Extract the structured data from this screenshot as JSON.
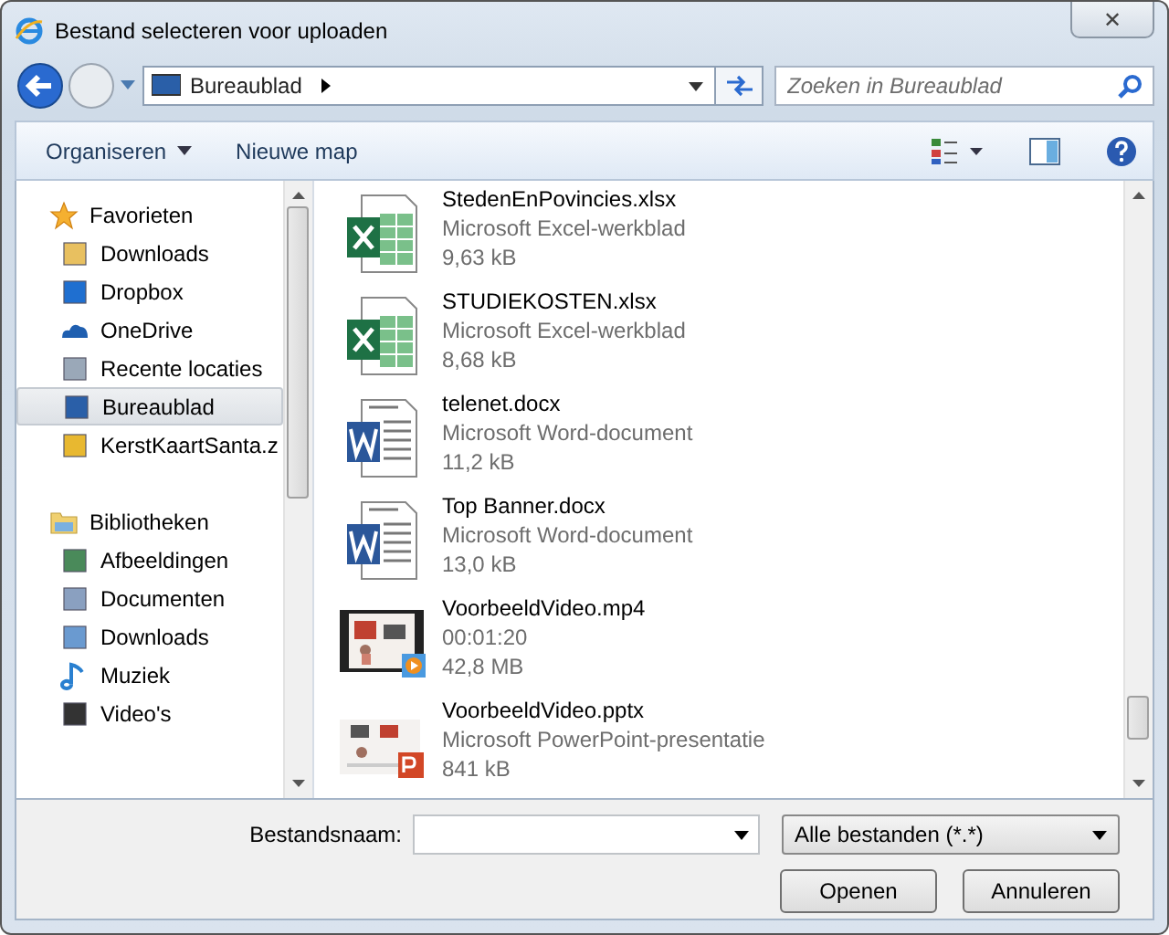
{
  "window": {
    "title": "Bestand selecteren voor uploaden",
    "close": "✕"
  },
  "address": {
    "location": "Bureaublad",
    "search_placeholder": "Zoeken in Bureaublad"
  },
  "toolbar": {
    "organise": "Organiseren",
    "new_folder": "Nieuwe map"
  },
  "sidebar": {
    "groups": [
      {
        "label": "Favorieten",
        "kind": "star",
        "children": [
          {
            "label": "Downloads",
            "kind": "downloads",
            "selected": false
          },
          {
            "label": "Dropbox",
            "kind": "dropbox",
            "selected": false
          },
          {
            "label": "OneDrive",
            "kind": "cloud",
            "selected": false
          },
          {
            "label": "Recente locaties",
            "kind": "recent",
            "selected": false
          },
          {
            "label": "Bureaublad",
            "kind": "desktop",
            "selected": true
          },
          {
            "label": "KerstKaartSanta.z",
            "kind": "shortcut",
            "selected": false
          }
        ]
      },
      {
        "label": "Bibliotheken",
        "kind": "library",
        "children": [
          {
            "label": "Afbeeldingen",
            "kind": "pictures",
            "selected": false
          },
          {
            "label": "Documenten",
            "kind": "documents",
            "selected": false
          },
          {
            "label": "Downloads",
            "kind": "downloads2",
            "selected": false
          },
          {
            "label": "Muziek",
            "kind": "music",
            "selected": false
          },
          {
            "label": "Video's",
            "kind": "videos",
            "selected": false
          }
        ]
      }
    ]
  },
  "files": [
    {
      "name": "StedenEnPovincies.xlsx",
      "kind": "excel",
      "type": "Microsoft Excel-werkblad",
      "size": "9,63 kB"
    },
    {
      "name": "STUDIEKOSTEN.xlsx",
      "kind": "excel",
      "type": "Microsoft Excel-werkblad",
      "size": "8,68 kB"
    },
    {
      "name": "telenet.docx",
      "kind": "word",
      "type": "Microsoft Word-document",
      "size": "11,2 kB"
    },
    {
      "name": "Top Banner.docx",
      "kind": "word",
      "type": "Microsoft Word-document",
      "size": "13,0 kB"
    },
    {
      "name": "VoorbeeldVideo.mp4",
      "kind": "video",
      "type": "00:01:20",
      "size": "42,8 MB"
    },
    {
      "name": "VoorbeeldVideo.pptx",
      "kind": "pptx",
      "type": "Microsoft PowerPoint-presentatie",
      "size": "841 kB"
    }
  ],
  "footer": {
    "filename_label": "Bestandsnaam:",
    "filter": "Alle bestanden (*.*)",
    "open": "Openen",
    "cancel": "Annuleren"
  }
}
